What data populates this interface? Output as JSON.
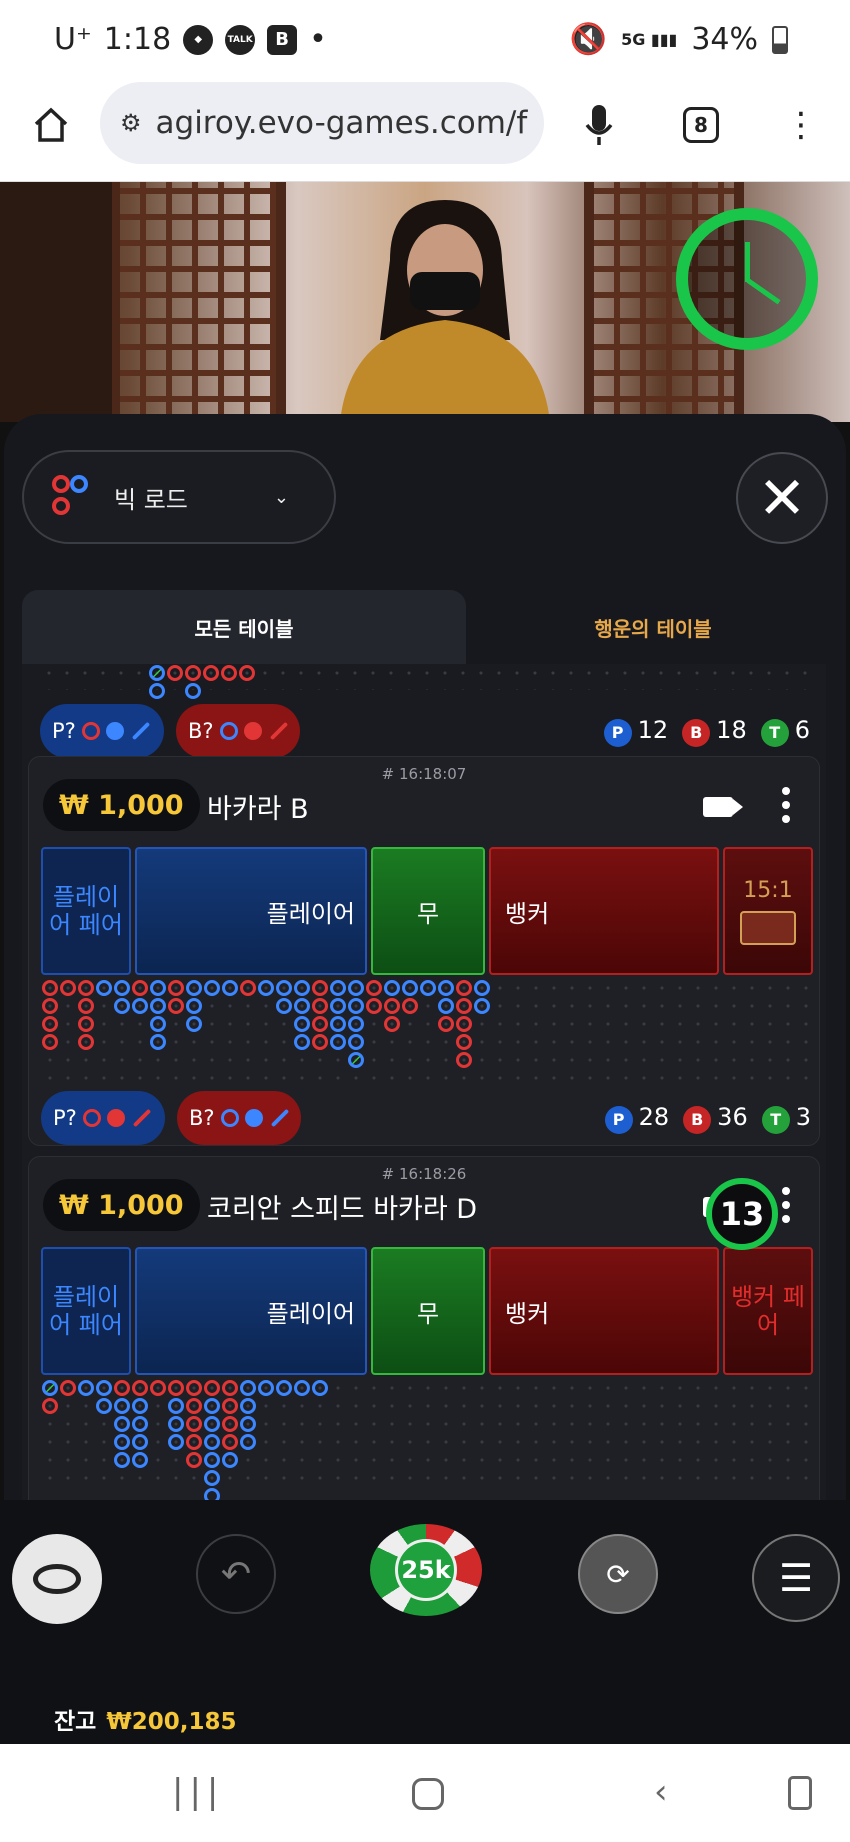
{
  "status": {
    "carrier": "U⁺",
    "time": "1:18",
    "talk": "TALK",
    "b_icon": "B",
    "dot": "•",
    "battery": "34%"
  },
  "browser": {
    "url": "agiroy.evo-games.com/f",
    "tabs": "8"
  },
  "road_selector": {
    "label": "빅 로드"
  },
  "tabs": {
    "all": "모든 테이블",
    "lucky": "행운의 테이블"
  },
  "cards": [
    {
      "p_ask": "P?",
      "b_ask": "B?",
      "p_count": "12",
      "b_count": "18",
      "t_count": "6"
    },
    {
      "timestamp": "# 16:18:07",
      "price": "₩ 1,000",
      "name": "바카라 B",
      "player_pair": "플레이어 페어",
      "player": "플레이어",
      "tie": "무",
      "banker": "뱅커",
      "odds": "15:1",
      "p_ask": "P?",
      "b_ask": "B?",
      "p_count": "28",
      "b_count": "36",
      "t_count": "3"
    },
    {
      "timestamp": "# 16:18:26",
      "price": "₩ 1,000",
      "name": "코리안 스피드 바카라 D",
      "player_pair": "플레이어 페어",
      "player": "플레이어",
      "tie": "무",
      "banker": "뱅커",
      "banker_pair": "뱅커 페어",
      "countdown": "13"
    }
  ],
  "badges": {
    "p": "P",
    "b": "B",
    "t": "T"
  },
  "controls": {
    "chip": "25k",
    "balance_label": "잔고",
    "balance_value": "₩200,185"
  },
  "colors": {
    "accent_gold": "#f6c739",
    "player_blue": "#3c86ff",
    "banker_red": "#e23636",
    "tie_green": "#2ecc40",
    "timer_green": "#19c64a"
  }
}
